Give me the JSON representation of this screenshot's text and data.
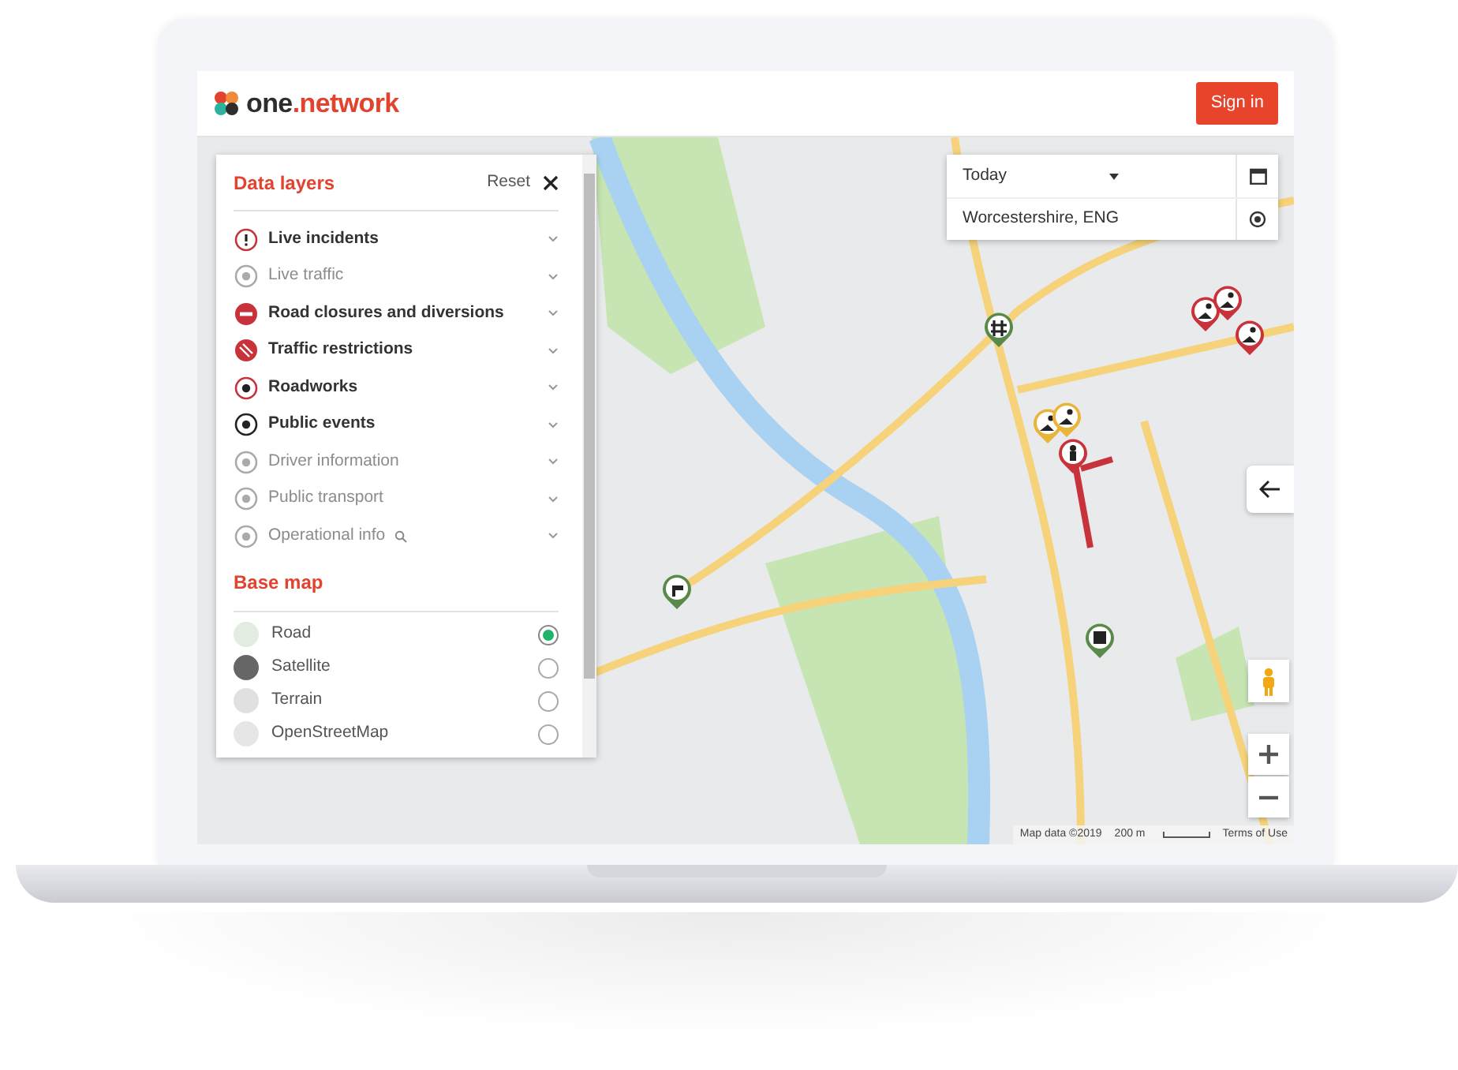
{
  "header": {
    "logo": {
      "name": "one",
      "suffix": ".network"
    },
    "sign_in": "Sign in"
  },
  "data_layers": {
    "title": "Data layers",
    "reset": "Reset",
    "layers": [
      {
        "label": "Live incidents",
        "kind": "incident",
        "active": true,
        "search_icon": false
      },
      {
        "label": "Live traffic",
        "kind": "traffic",
        "active": false,
        "search_icon": false
      },
      {
        "label": "Road closures and diversions",
        "kind": "closure",
        "active": true,
        "search_icon": false
      },
      {
        "label": "Traffic restrictions",
        "kind": "restriction",
        "active": true,
        "search_icon": false
      },
      {
        "label": "Roadworks",
        "kind": "roadworks",
        "active": true,
        "search_icon": false
      },
      {
        "label": "Public events",
        "kind": "events",
        "active": true,
        "search_icon": false
      },
      {
        "label": "Driver information",
        "kind": "driver",
        "active": false,
        "search_icon": false
      },
      {
        "label": "Public transport",
        "kind": "transport",
        "active": false,
        "search_icon": false
      },
      {
        "label": "Operational info",
        "kind": "operational",
        "active": false,
        "search_icon": true
      }
    ]
  },
  "base_map": {
    "title": "Base map",
    "options": [
      {
        "label": "Road",
        "kind": "road",
        "selected": true
      },
      {
        "label": "Satellite",
        "kind": "satellite",
        "selected": false
      },
      {
        "label": "Terrain",
        "kind": "terrain",
        "selected": false
      },
      {
        "label": "OpenStreetMap",
        "kind": "osm",
        "selected": false
      }
    ]
  },
  "filters": {
    "date": "Today",
    "location": "Worcestershire, ENG"
  },
  "markers": [
    {
      "kind": "hash",
      "color": "#5a8a4a"
    },
    {
      "kind": "works",
      "color": "#c8323a"
    },
    {
      "kind": "works",
      "color": "#c8323a"
    },
    {
      "kind": "works",
      "color": "#c8323a"
    },
    {
      "kind": "works",
      "color": "#e8b53a"
    },
    {
      "kind": "works",
      "color": "#e8b53a"
    },
    {
      "kind": "person",
      "color": "#c8323a"
    },
    {
      "kind": "tap",
      "color": "#5a8a4a"
    },
    {
      "kind": "building",
      "color": "#5a8a4a"
    }
  ],
  "attribution": {
    "map_data": "Map data ©2019",
    "scale": "200 m",
    "terms": "Terms of Use"
  }
}
